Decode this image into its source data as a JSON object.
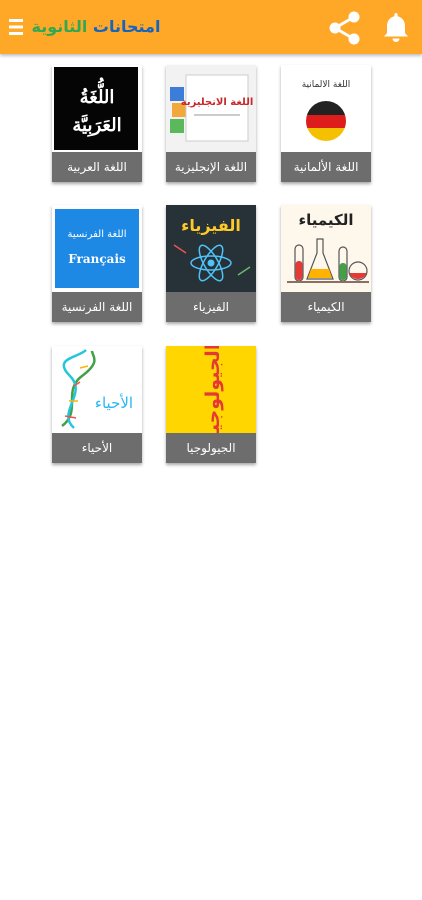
{
  "header": {
    "title_part1": "امتحانات",
    "title_part2": "الثانوية",
    "icons": {
      "notifications": "bell-icon",
      "share": "share-icon",
      "menu": "menu-icon"
    },
    "colors": {
      "bar": "#ffa726",
      "title_part1": "#1565c0",
      "title_part2": "#33a852"
    }
  },
  "subjects": [
    {
      "label": "اللغة الألمانية",
      "thumb_text": "اللغة الالمانية"
    },
    {
      "label": "اللغة الإنجليزية",
      "thumb_text": "اللغة الانجليزية"
    },
    {
      "label": "اللغة العربية",
      "thumb_line1": "اللُّغَةُ",
      "thumb_line2": "العَرَبِيَّة"
    },
    {
      "label": "الكيمياء",
      "thumb_text": "الكيمياء"
    },
    {
      "label": "الفيزياء",
      "thumb_text": "الفيزياء"
    },
    {
      "label": "اللغة الفرنسية",
      "thumb_line1": "اللغة الفرنسية",
      "thumb_line2": "Français"
    },
    {
      "label": "الجيولوجيا",
      "thumb_text": "الجيولوجيا"
    },
    {
      "label": "الأحياء",
      "thumb_text": "الأحياء"
    }
  ]
}
